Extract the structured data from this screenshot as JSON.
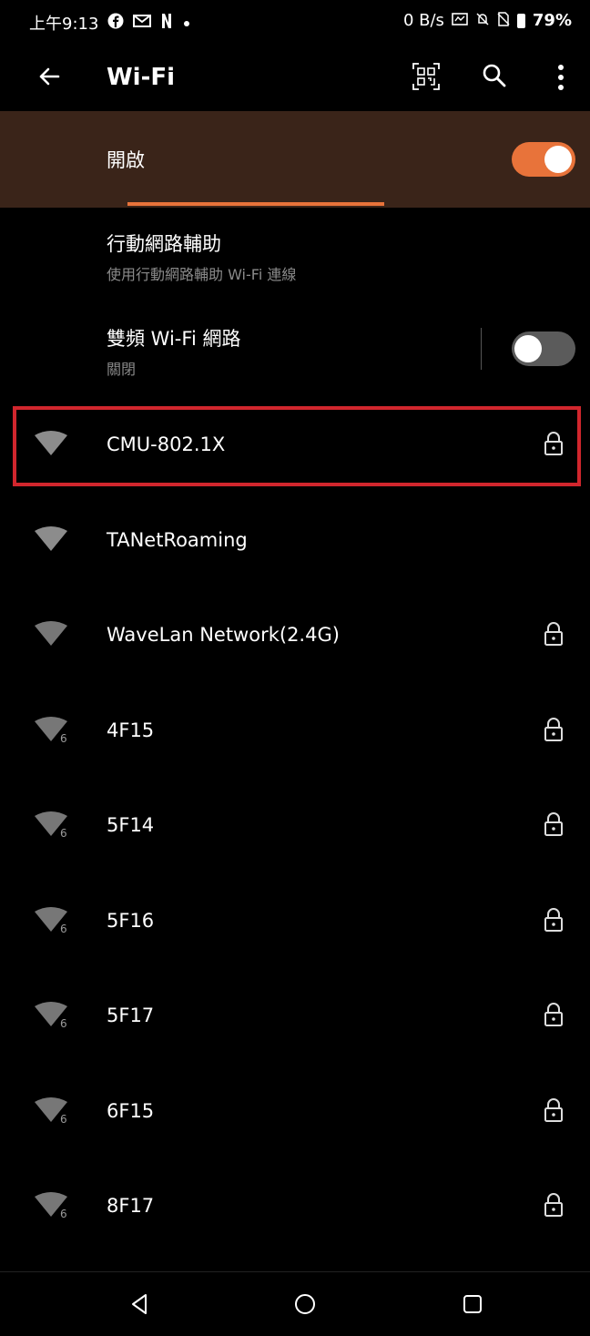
{
  "status_bar": {
    "time": "上午9:13",
    "notification_icons": [
      "facebook-icon",
      "gmail-icon",
      "netflix-icon",
      "dot-icon"
    ],
    "net_speed": "0 B/s",
    "status_icons": [
      "data-saver-icon",
      "mute-icon",
      "no-sim-icon"
    ],
    "battery": "79%"
  },
  "appbar": {
    "title": "Wi-Fi"
  },
  "open_toggle": {
    "label": "開啟",
    "on": true
  },
  "mobile_assist": {
    "title": "行動網路輔助",
    "subtitle": "使用行動網路輔助 Wi-Fi 連線"
  },
  "dual_band": {
    "title": "雙頻 Wi-Fi 網路",
    "subtitle": "關閉",
    "on": false
  },
  "networks": [
    {
      "name": "CMU-802.1X",
      "wifi6": false,
      "locked": true,
      "highlighted": true
    },
    {
      "name": "TANetRoaming",
      "wifi6": false,
      "locked": false
    },
    {
      "name": "WaveLan Network(2.4G)",
      "wifi6": false,
      "locked": true
    },
    {
      "name": "4F15",
      "wifi6": true,
      "locked": true
    },
    {
      "name": "5F14",
      "wifi6": true,
      "locked": true
    },
    {
      "name": "5F16",
      "wifi6": true,
      "locked": true
    },
    {
      "name": "5F17",
      "wifi6": true,
      "locked": true
    },
    {
      "name": "6F15",
      "wifi6": true,
      "locked": true
    },
    {
      "name": "8F17",
      "wifi6": true,
      "locked": true
    }
  ],
  "wifi6_badge": "6",
  "colors": {
    "accent": "#e8733a",
    "highlight_border": "#d1262d",
    "toggle_bar_bg": "#3a2419"
  }
}
